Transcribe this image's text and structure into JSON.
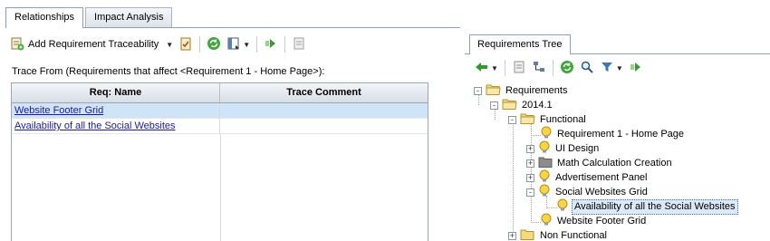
{
  "left": {
    "tabs": [
      {
        "label": "Relationships",
        "active": true
      },
      {
        "label": "Impact Analysis",
        "active": false
      }
    ],
    "toolbar": {
      "add_traceability_label": "Add Requirement Traceability"
    },
    "trace_caption": "Trace From (Requirements that affect <Requirement 1 - Home Page>):",
    "grid": {
      "columns": [
        "Req: Name",
        "Trace Comment"
      ],
      "rows": [
        {
          "name": "Website Footer Grid",
          "comment": "",
          "selected": true
        },
        {
          "name": "Availability of all the Social Websites",
          "comment": "",
          "selected": false
        }
      ]
    }
  },
  "right": {
    "tab_label": "Requirements Tree",
    "tree": [
      {
        "label": "Requirements",
        "icon": "folder-open-icon",
        "expander": "-",
        "depth": 0
      },
      {
        "label": "2014.1",
        "icon": "folder-open-icon",
        "expander": "-",
        "depth": 1
      },
      {
        "label": "Functional",
        "icon": "folder-open-icon",
        "expander": "-",
        "depth": 2
      },
      {
        "label": "Requirement 1 - Home Page",
        "icon": "lightbulb-icon",
        "expander": "",
        "depth": 3
      },
      {
        "label": "UI Design",
        "icon": "lightbulb-icon",
        "expander": "+",
        "depth": 3
      },
      {
        "label": "Math Calculation Creation",
        "icon": "folder-grey-icon",
        "expander": "+",
        "depth": 3
      },
      {
        "label": "Advertisement Panel",
        "icon": "lightbulb-icon",
        "expander": "+",
        "depth": 3
      },
      {
        "label": "Social Websites Grid",
        "icon": "lightbulb-icon",
        "expander": "-",
        "depth": 3
      },
      {
        "label": "Availability of all the Social Websites",
        "icon": "lightbulb-icon",
        "expander": "",
        "depth": 4,
        "selected": true
      },
      {
        "label": "Website Footer Grid",
        "icon": "lightbulb-icon",
        "expander": "",
        "depth": 3
      },
      {
        "label": "Non Functional",
        "icon": "folder-closed-icon",
        "expander": "+",
        "depth": 2
      }
    ]
  },
  "colors": {
    "selected_row": "#cfe4f7",
    "link": "#1a1a9a",
    "border": "#8fa0b5"
  }
}
